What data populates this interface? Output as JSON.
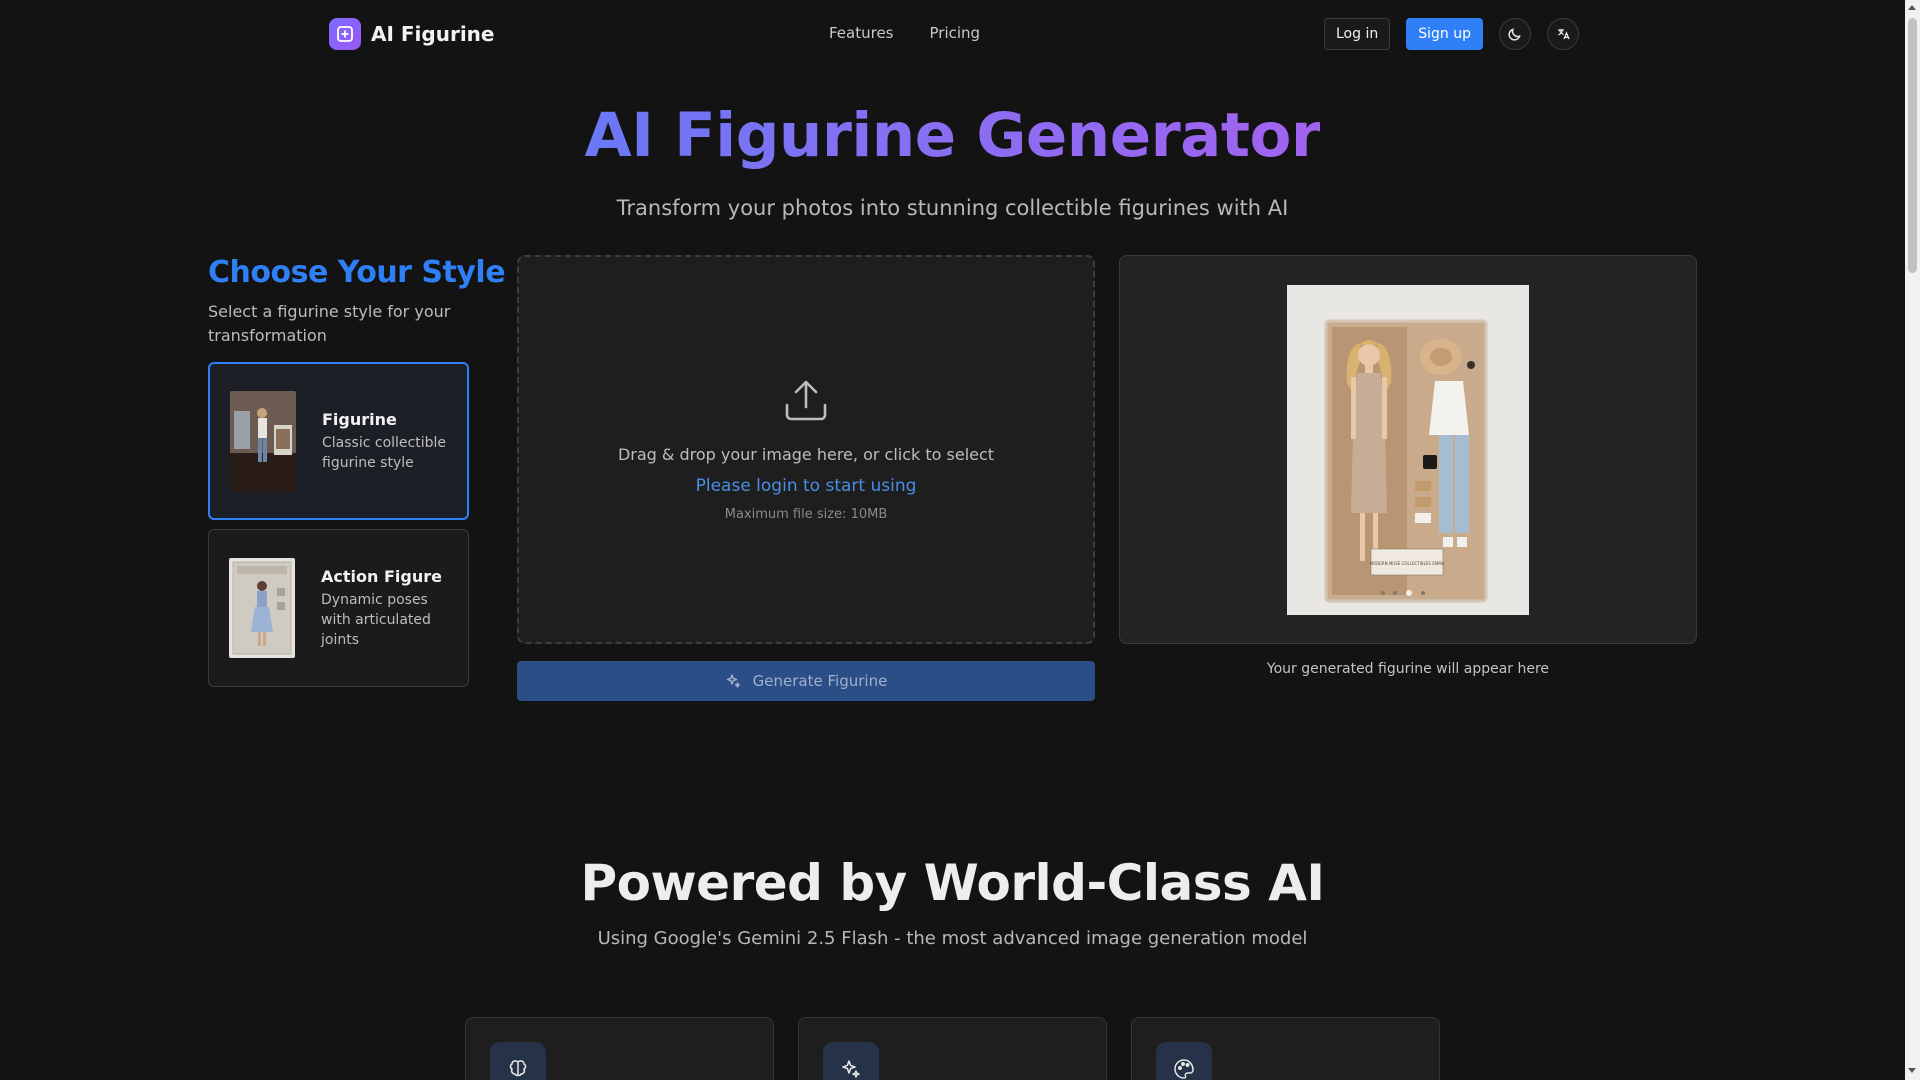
{
  "header": {
    "brand": "AI Figurine",
    "nav": [
      "Features",
      "Pricing"
    ],
    "login_label": "Log in",
    "signup_label": "Sign up",
    "theme_icon": "moon-icon",
    "language_icon": "translate-icon"
  },
  "hero": {
    "title": "AI Figurine Generator",
    "subtitle": "Transform your photos into stunning collectible figurines with AI"
  },
  "styles": {
    "title": "Choose Your Style",
    "subtitle": "Select a figurine style for your transformation",
    "items": [
      {
        "name": "Figurine",
        "desc": "Classic collectible figurine style",
        "selected": true
      },
      {
        "name": "Action Figure",
        "desc": "Dynamic poses with articulated joints",
        "selected": false
      }
    ]
  },
  "upload": {
    "prompt": "Drag & drop your image here, or click to select",
    "login_text": "Please login to start using",
    "max_size": "Maximum file size: 10MB"
  },
  "generate_label": "Generate Figurine",
  "preview": {
    "caption": "Your generated figurine will appear here",
    "box_text": "MODERN MUSE COLLECTIBLES EMMA"
  },
  "powered": {
    "title": "Powered by World-Class AI",
    "subtitle": "Using Google's Gemini 2.5 Flash - the most advanced image generation model",
    "feature_icons": [
      "brain-icon",
      "sparkles-icon",
      "palette-icon"
    ]
  },
  "colors": {
    "accent": "#2f7ff7",
    "background": "#131313",
    "gradient_start": "#6a78f5",
    "gradient_end": "#a262f0"
  }
}
